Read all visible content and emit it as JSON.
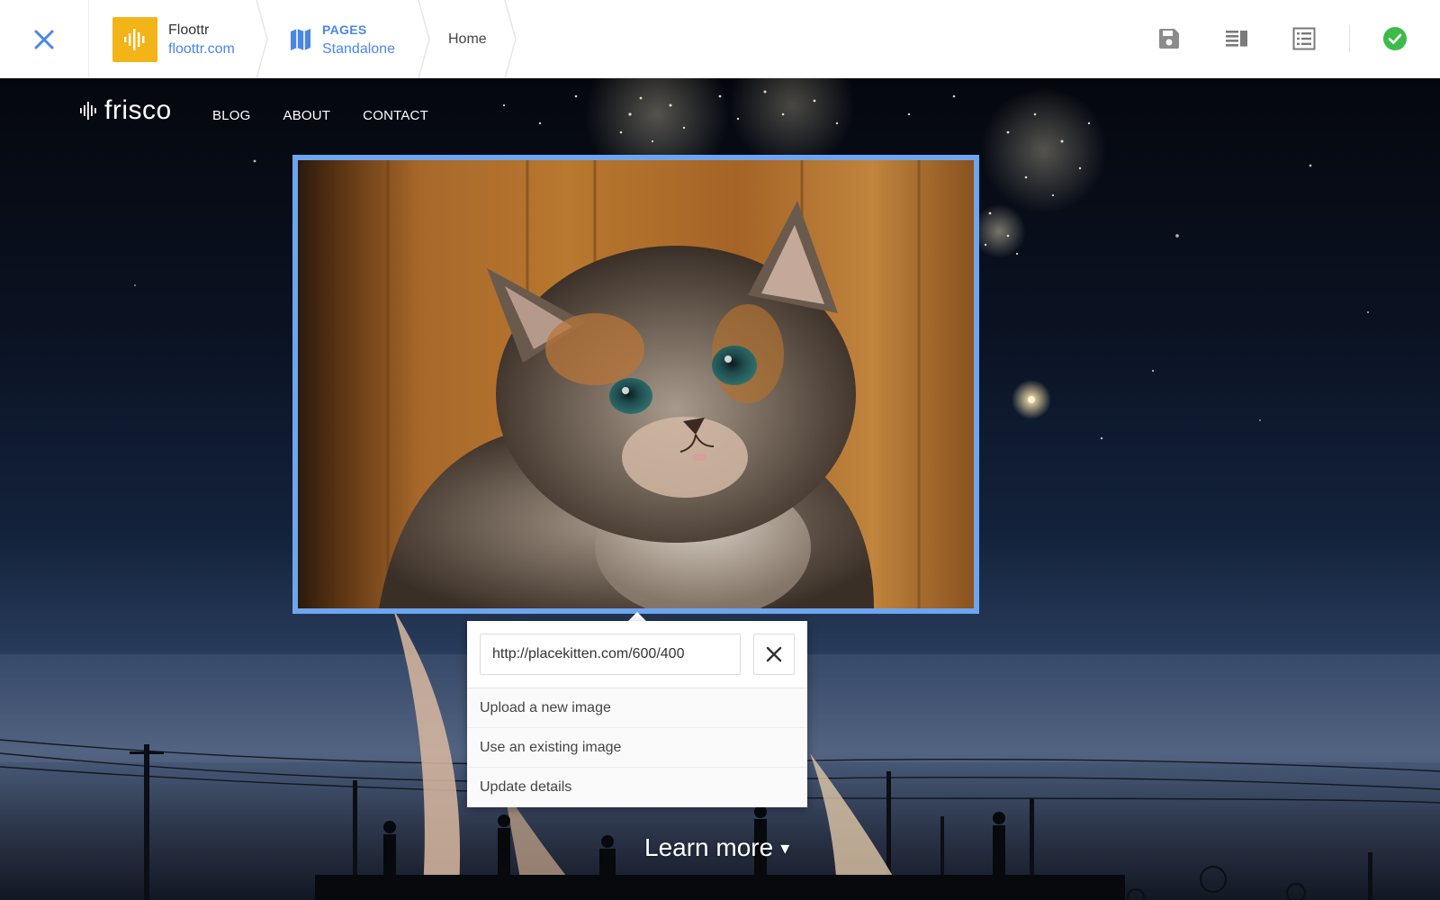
{
  "editor": {
    "site": {
      "name": "Floottr",
      "domain": "floottr.com"
    },
    "pages": {
      "kicker": "PAGES",
      "type": "Standalone"
    },
    "current_page": "Home",
    "tools": [
      "save-icon",
      "layout-icon",
      "list-details-icon",
      "check-circle-icon"
    ],
    "colors": {
      "accent": "#4a86e8",
      "logo_bg": "#f2b417",
      "publish": "#3dbb4a",
      "selection": "#6ea5ee"
    }
  },
  "site": {
    "logo": "frisco",
    "nav": [
      "BLOG",
      "ABOUT",
      "CONTACT"
    ],
    "learn_more": "Learn more",
    "learn_more_caret": "▾"
  },
  "image_popover": {
    "url": "http://placekitten.com/600/400",
    "menu": [
      "Upload a new image",
      "Use an existing image",
      "Update details"
    ]
  }
}
